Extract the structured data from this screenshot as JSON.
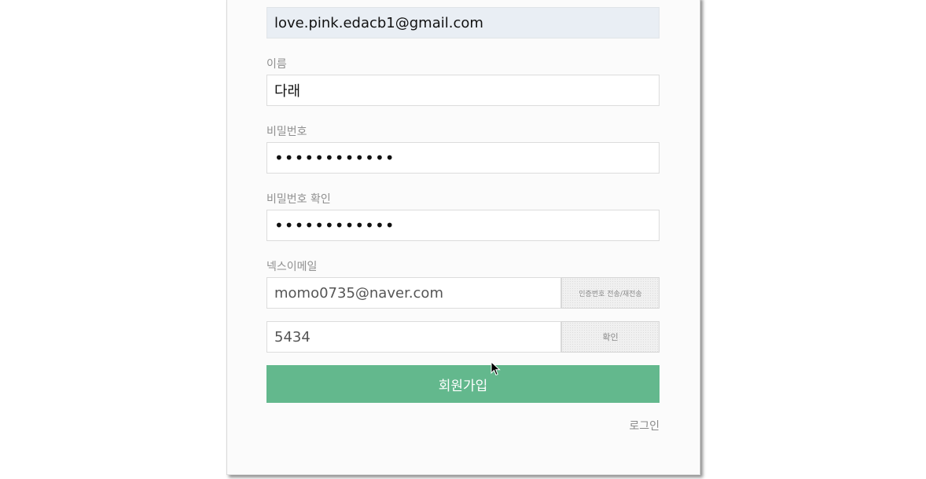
{
  "form": {
    "account_email": "love.pink.edacb1@gmail.com",
    "name_label": "이름",
    "name_value": "다래",
    "password_label": "비밀번호",
    "password_value": "••••••••••••",
    "password_confirm_label": "비밀번호 확인",
    "password_confirm_value": "••••••••••••",
    "nexus_email_label": "넥스이메일",
    "nexus_email_value": "momo0735@naver.com",
    "send_code_label": "인증번호 전송/재전송",
    "code_value": "5434",
    "confirm_label": "확인",
    "signup_label": "회원가입",
    "login_label": "로그인"
  },
  "colors": {
    "primary_green": "#63b88d",
    "readonly_bg": "#e9eef4"
  },
  "icons": {
    "cursor": "arrow-cursor-icon"
  }
}
